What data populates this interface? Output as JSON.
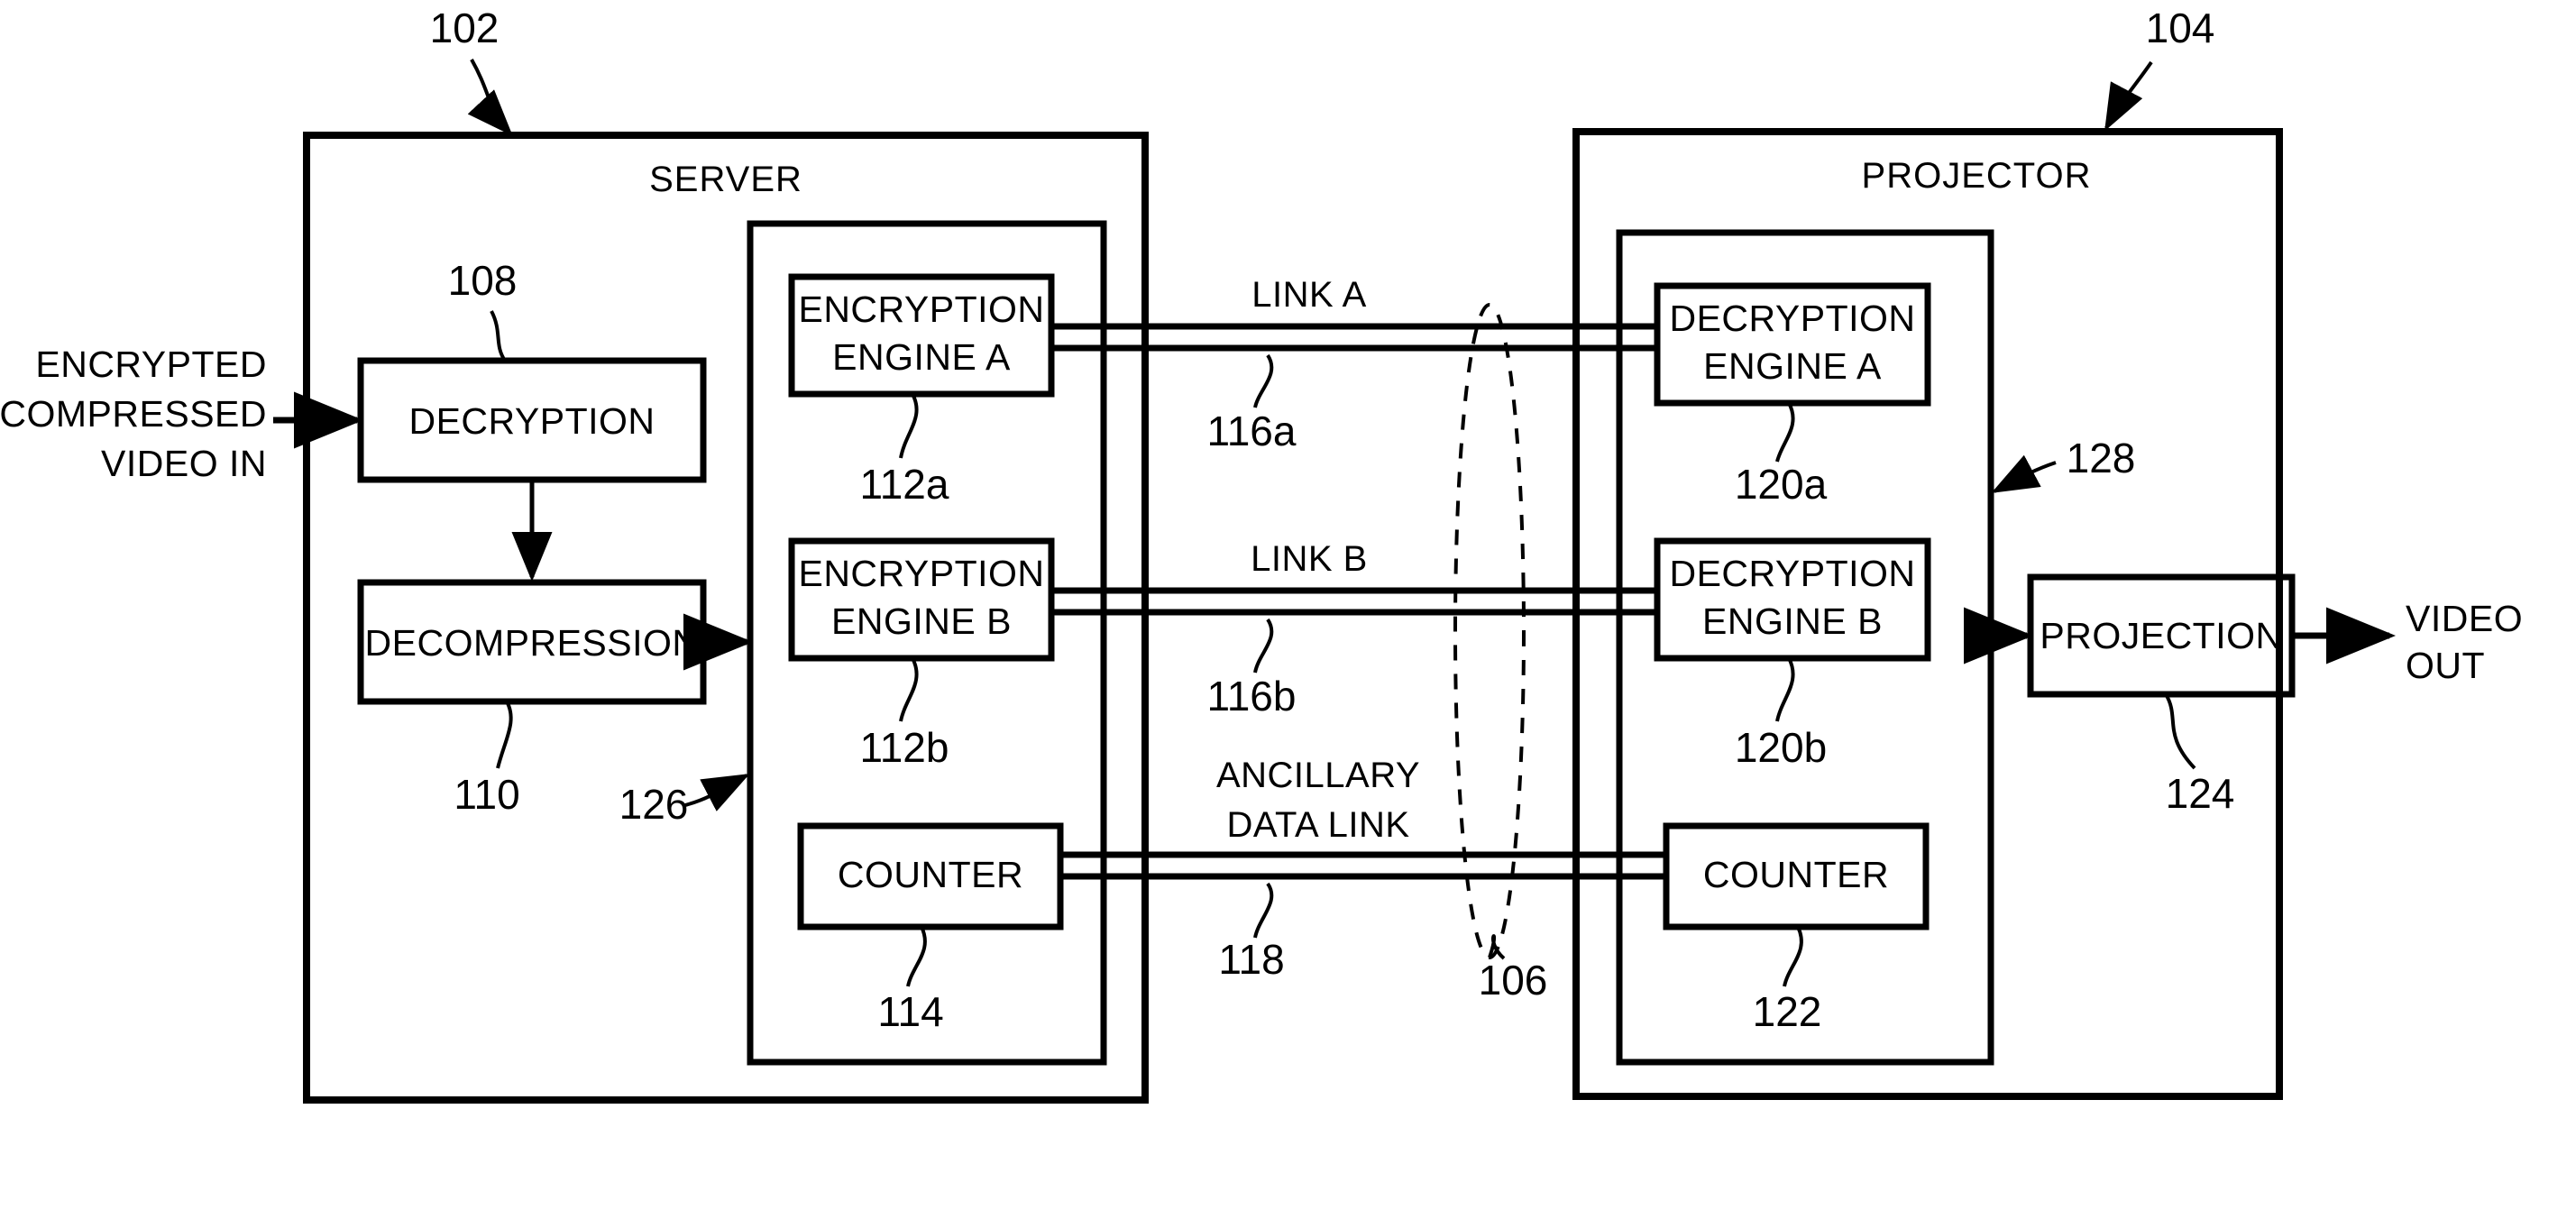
{
  "figure": {
    "title": "Encrypted video link between server and projector",
    "stroke_color": "#000000",
    "background_color": "#ffffff"
  },
  "server": {
    "title": "SERVER",
    "ref": "102",
    "security_module_ref": "126",
    "blocks": {
      "decryption": {
        "label": "DECRYPTION",
        "ref": "108"
      },
      "decompression": {
        "label": "DECOMPRESSION",
        "ref": "110"
      },
      "encryption_engine_a": {
        "label_line1": "ENCRYPTION",
        "label_line2": "ENGINE A",
        "ref": "112a"
      },
      "encryption_engine_b": {
        "label_line1": "ENCRYPTION",
        "label_line2": "ENGINE B",
        "ref": "112b"
      },
      "counter": {
        "label": "COUNTER",
        "ref": "114"
      }
    }
  },
  "projector": {
    "title": "PROJECTOR",
    "ref": "104",
    "security_module_ref": "128",
    "blocks": {
      "decryption_engine_a": {
        "label_line1": "DECRYPTION",
        "label_line2": "ENGINE A",
        "ref": "120a"
      },
      "decryption_engine_b": {
        "label_line1": "DECRYPTION",
        "label_line2": "ENGINE B",
        "ref": "120b"
      },
      "counter": {
        "label": "COUNTER",
        "ref": "122"
      },
      "projection": {
        "label": "PROJECTION",
        "ref": "124"
      }
    }
  },
  "links": {
    "link_a": {
      "label": "LINK A",
      "ref": "116a"
    },
    "link_b": {
      "label": "LINK B",
      "ref": "116b"
    },
    "ancillary": {
      "label_line1": "ANCILLARY",
      "label_line2": "DATA LINK",
      "ref": "118"
    },
    "bundle_ref": "106"
  },
  "io": {
    "input": {
      "line1": "ENCRYPTED",
      "line2": "COMPRESSED",
      "line3": "VIDEO IN"
    },
    "output": {
      "line1": "VIDEO",
      "line2": "OUT"
    }
  }
}
